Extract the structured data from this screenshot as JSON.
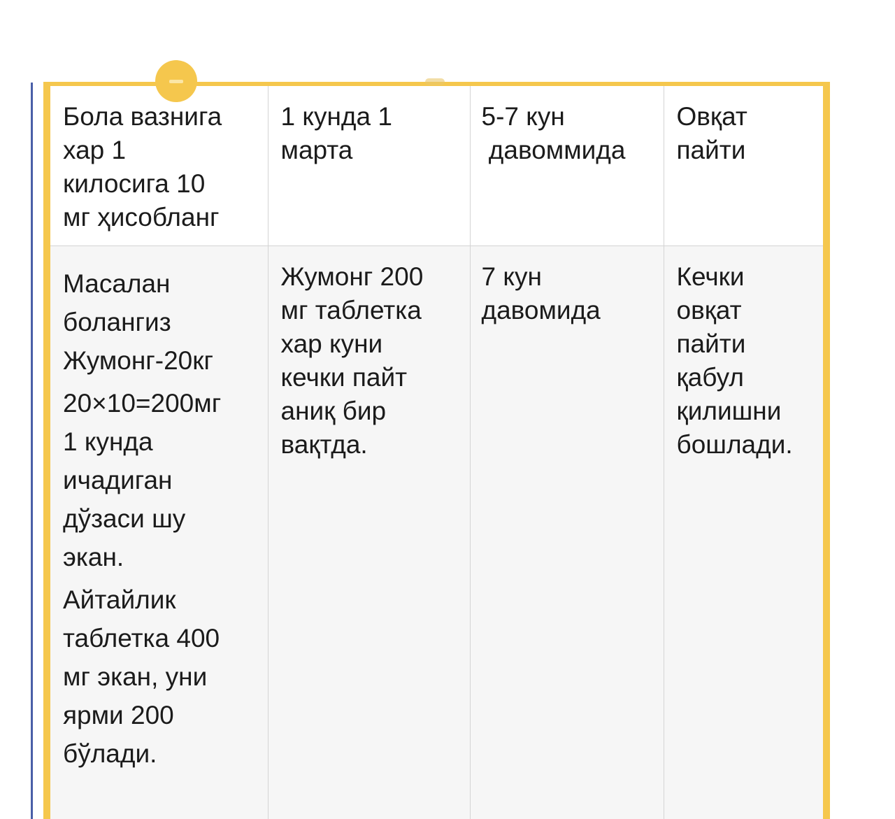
{
  "table": {
    "header": {
      "weight_rule": [
        "Бола вазнига",
        "хар 1",
        "килосига 10",
        "мг ҳисобланг"
      ],
      "frequency": [
        "1 кунда 1",
        "марта"
      ],
      "duration": [
        "5-7 кун",
        " давоммида"
      ],
      "timing": [
        "Овқат",
        "пайти"
      ]
    },
    "row": {
      "example_intro": [
        "Масалан",
        "болангиз",
        "Жумонг-20кг"
      ],
      "example_calc": [
        "20×10=200мг",
        "1 кунда",
        "ичадиган",
        "дўзаси шу",
        "экан."
      ],
      "example_tablet": [
        "Айтайлик",
        "таблетка 400",
        "мг экан, уни",
        "ярми 200",
        "бўлади."
      ],
      "dose_instruction": [
        "Жумонг 200",
        "мг таблетка",
        "хар куни",
        "кечки пайт",
        "аниқ бир",
        "вақтда."
      ],
      "duration_value": [
        "7 кун",
        "давомида"
      ],
      "timing_value": [
        "Кечки",
        "овқат",
        "пайти",
        "қабул",
        "қилишни",
        "бошлади."
      ]
    }
  },
  "colors": {
    "frame_border": "#f5c74d",
    "left_rule": "#4a5fa8",
    "header_bg": "#ffffff",
    "body_bg": "#f6f6f6",
    "grid_line": "#d4d4d4",
    "text": "#1b1b1b"
  }
}
